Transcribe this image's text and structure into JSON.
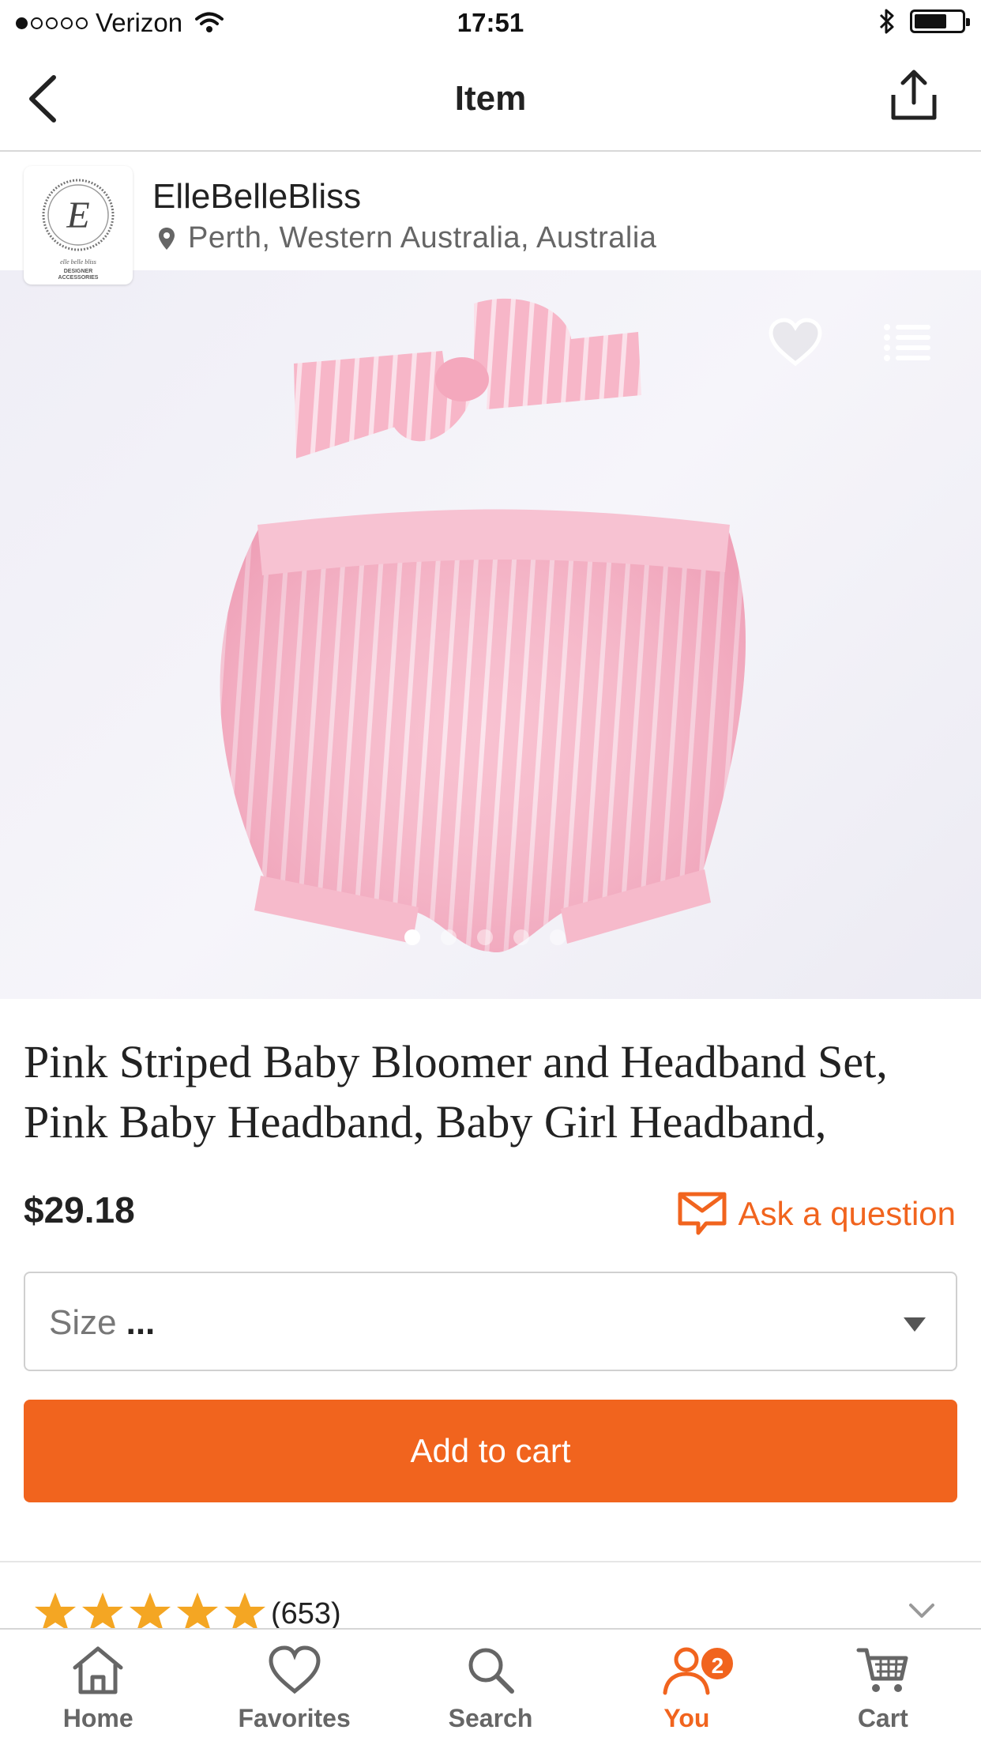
{
  "status_bar": {
    "carrier": "Verizon",
    "time": "17:51"
  },
  "nav": {
    "title": "Item"
  },
  "shop": {
    "name": "ElleBelleBliss",
    "location": "Perth, Western Australia, Australia",
    "logo_initial": "E",
    "logo_line1": "elle belle bliss",
    "logo_line2": "DESIGNER",
    "logo_line3": "ACCESSORIES"
  },
  "gallery": {
    "image_count": 5,
    "active_index": 0
  },
  "product": {
    "title": "Pink Striped Baby Bloomer and Headband Set, Pink Baby Headband, Baby Girl Headband,",
    "price": "$29.18",
    "ask_question": "Ask a question"
  },
  "size_select": {
    "label": "Size",
    "value": "..."
  },
  "add_to_cart": "Add to cart",
  "reviews": {
    "stars": 5,
    "count": "(653)"
  },
  "tabs": [
    {
      "label": "Home",
      "icon": "home-icon"
    },
    {
      "label": "Favorites",
      "icon": "heart-icon"
    },
    {
      "label": "Search",
      "icon": "search-icon"
    },
    {
      "label": "You",
      "icon": "user-icon",
      "badge": "2"
    },
    {
      "label": "Cart",
      "icon": "cart-icon"
    }
  ],
  "colors": {
    "accent": "#f1641e",
    "star": "#f4a623"
  }
}
